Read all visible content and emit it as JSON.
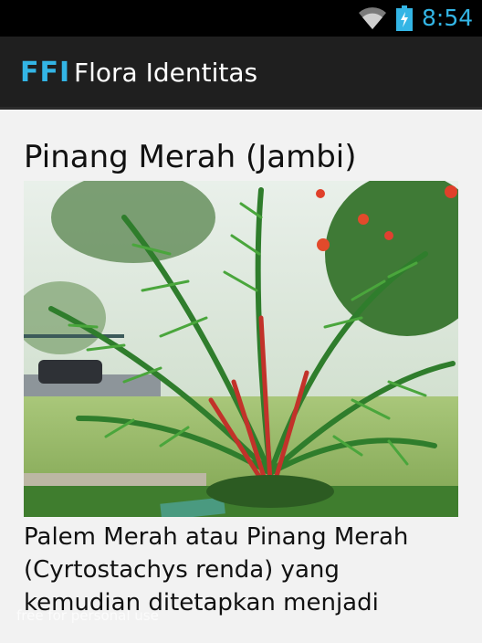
{
  "status_bar": {
    "time": "8:54",
    "icons": [
      "wifi-icon",
      "battery-icon"
    ],
    "accent_color": "#33b5e5"
  },
  "action_bar": {
    "logo": "FFI",
    "title": "Flora Identitas",
    "logo_color": "#33b5e5"
  },
  "main": {
    "plant_title": "Pinang Merah (Jambi)",
    "description": "Palem Merah atau Pinang Merah (Cyrtostachys renda) yang kemudian ditetapkan menjadi"
  },
  "watermark": "free for personal use"
}
